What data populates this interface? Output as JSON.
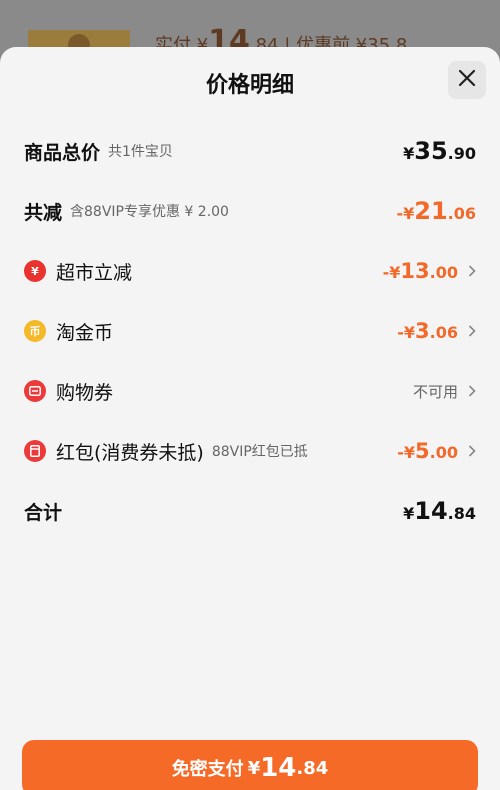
{
  "background": {
    "text_prefix": "实付 ¥",
    "text_int": "14",
    "text_rest": ".84 | 优惠前 ¥35.8"
  },
  "sheet": {
    "title": "价格明细",
    "close_icon": "close-icon"
  },
  "rows": [
    {
      "label": "商品总价",
      "sub": "共1件宝贝",
      "currency": "¥",
      "int": "35",
      "dec": ".90"
    },
    {
      "label": "共减",
      "sub": "含88VIP专享优惠 ¥ 2.00",
      "currency": "-¥",
      "int": "21",
      "dec": ".06"
    },
    {
      "label": "超市立减",
      "icon": "red-coin-icon",
      "currency": "-¥",
      "int": "13",
      "dec": ".00"
    },
    {
      "label": "淘金币",
      "icon": "gold-coin-icon",
      "currency": "-¥",
      "int": "3",
      "dec": ".06"
    },
    {
      "label": "购物券",
      "icon": "coupon-icon",
      "value_text": "不可用"
    },
    {
      "label": "红包(消费券未抵)",
      "sub": "88VIP红包已抵",
      "icon": "red-packet-icon",
      "currency": "-¥",
      "int": "5",
      "dec": ".00"
    },
    {
      "label": "合计",
      "currency": "¥",
      "int": "14",
      "dec": ".84"
    }
  ],
  "pay_button": {
    "label": "免密支付",
    "currency": "¥",
    "int": "14",
    "dec": ".84"
  },
  "colors": {
    "accent": "#f66a28",
    "discount": "#f2692a",
    "sheet_bg": "#f4f4f4"
  }
}
